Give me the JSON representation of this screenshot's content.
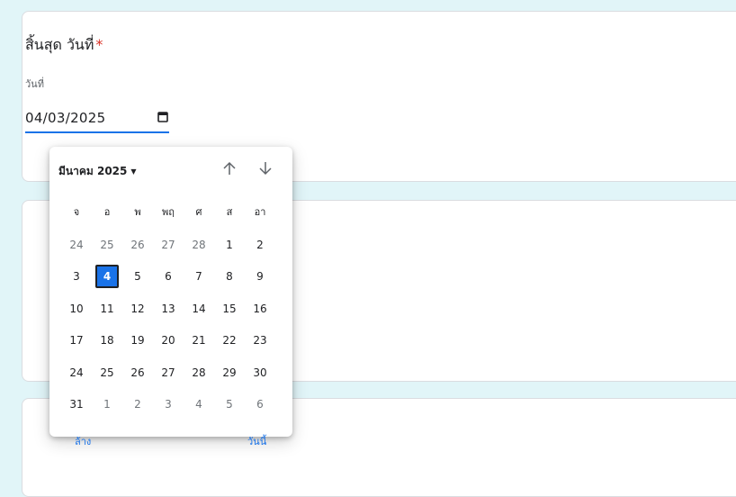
{
  "form": {
    "question_title": "สิ้นสุด วันที่",
    "required_mark": "*",
    "date_label": "วันที่",
    "date_value": "04/03/2025",
    "icons": {
      "calendar": "calendar-icon"
    }
  },
  "datepicker": {
    "month_label": "มีนาคม 2025",
    "weekdays": [
      "จ",
      "อ",
      "พ",
      "พฤ",
      "ศ",
      "ส",
      "อา"
    ],
    "weeks": [
      [
        {
          "d": "24",
          "o": true
        },
        {
          "d": "25",
          "o": true
        },
        {
          "d": "26",
          "o": true
        },
        {
          "d": "27",
          "o": true
        },
        {
          "d": "28",
          "o": true
        },
        {
          "d": "1"
        },
        {
          "d": "2"
        }
      ],
      [
        {
          "d": "3"
        },
        {
          "d": "4",
          "s": true
        },
        {
          "d": "5"
        },
        {
          "d": "6"
        },
        {
          "d": "7"
        },
        {
          "d": "8"
        },
        {
          "d": "9"
        }
      ],
      [
        {
          "d": "10"
        },
        {
          "d": "11"
        },
        {
          "d": "12"
        },
        {
          "d": "13"
        },
        {
          "d": "14"
        },
        {
          "d": "15"
        },
        {
          "d": "16"
        }
      ],
      [
        {
          "d": "17"
        },
        {
          "d": "18"
        },
        {
          "d": "19"
        },
        {
          "d": "20"
        },
        {
          "d": "21"
        },
        {
          "d": "22"
        },
        {
          "d": "23"
        }
      ],
      [
        {
          "d": "24"
        },
        {
          "d": "25"
        },
        {
          "d": "26"
        },
        {
          "d": "27"
        },
        {
          "d": "28"
        },
        {
          "d": "29"
        },
        {
          "d": "30"
        }
      ],
      [
        {
          "d": "31"
        },
        {
          "d": "1",
          "o": true
        },
        {
          "d": "2",
          "o": true
        },
        {
          "d": "3",
          "o": true
        },
        {
          "d": "4",
          "o": true
        },
        {
          "d": "5",
          "o": true
        },
        {
          "d": "6",
          "o": true
        }
      ]
    ],
    "clear_label": "ล้าง",
    "today_label": "วันนี้",
    "icons": {
      "prev": "arrow-up-icon",
      "next": "arrow-down-icon",
      "caret": "caret-down-icon"
    }
  },
  "colors": {
    "accent": "#1a73e8",
    "required": "#d93025",
    "background": "#e1f5f8"
  }
}
